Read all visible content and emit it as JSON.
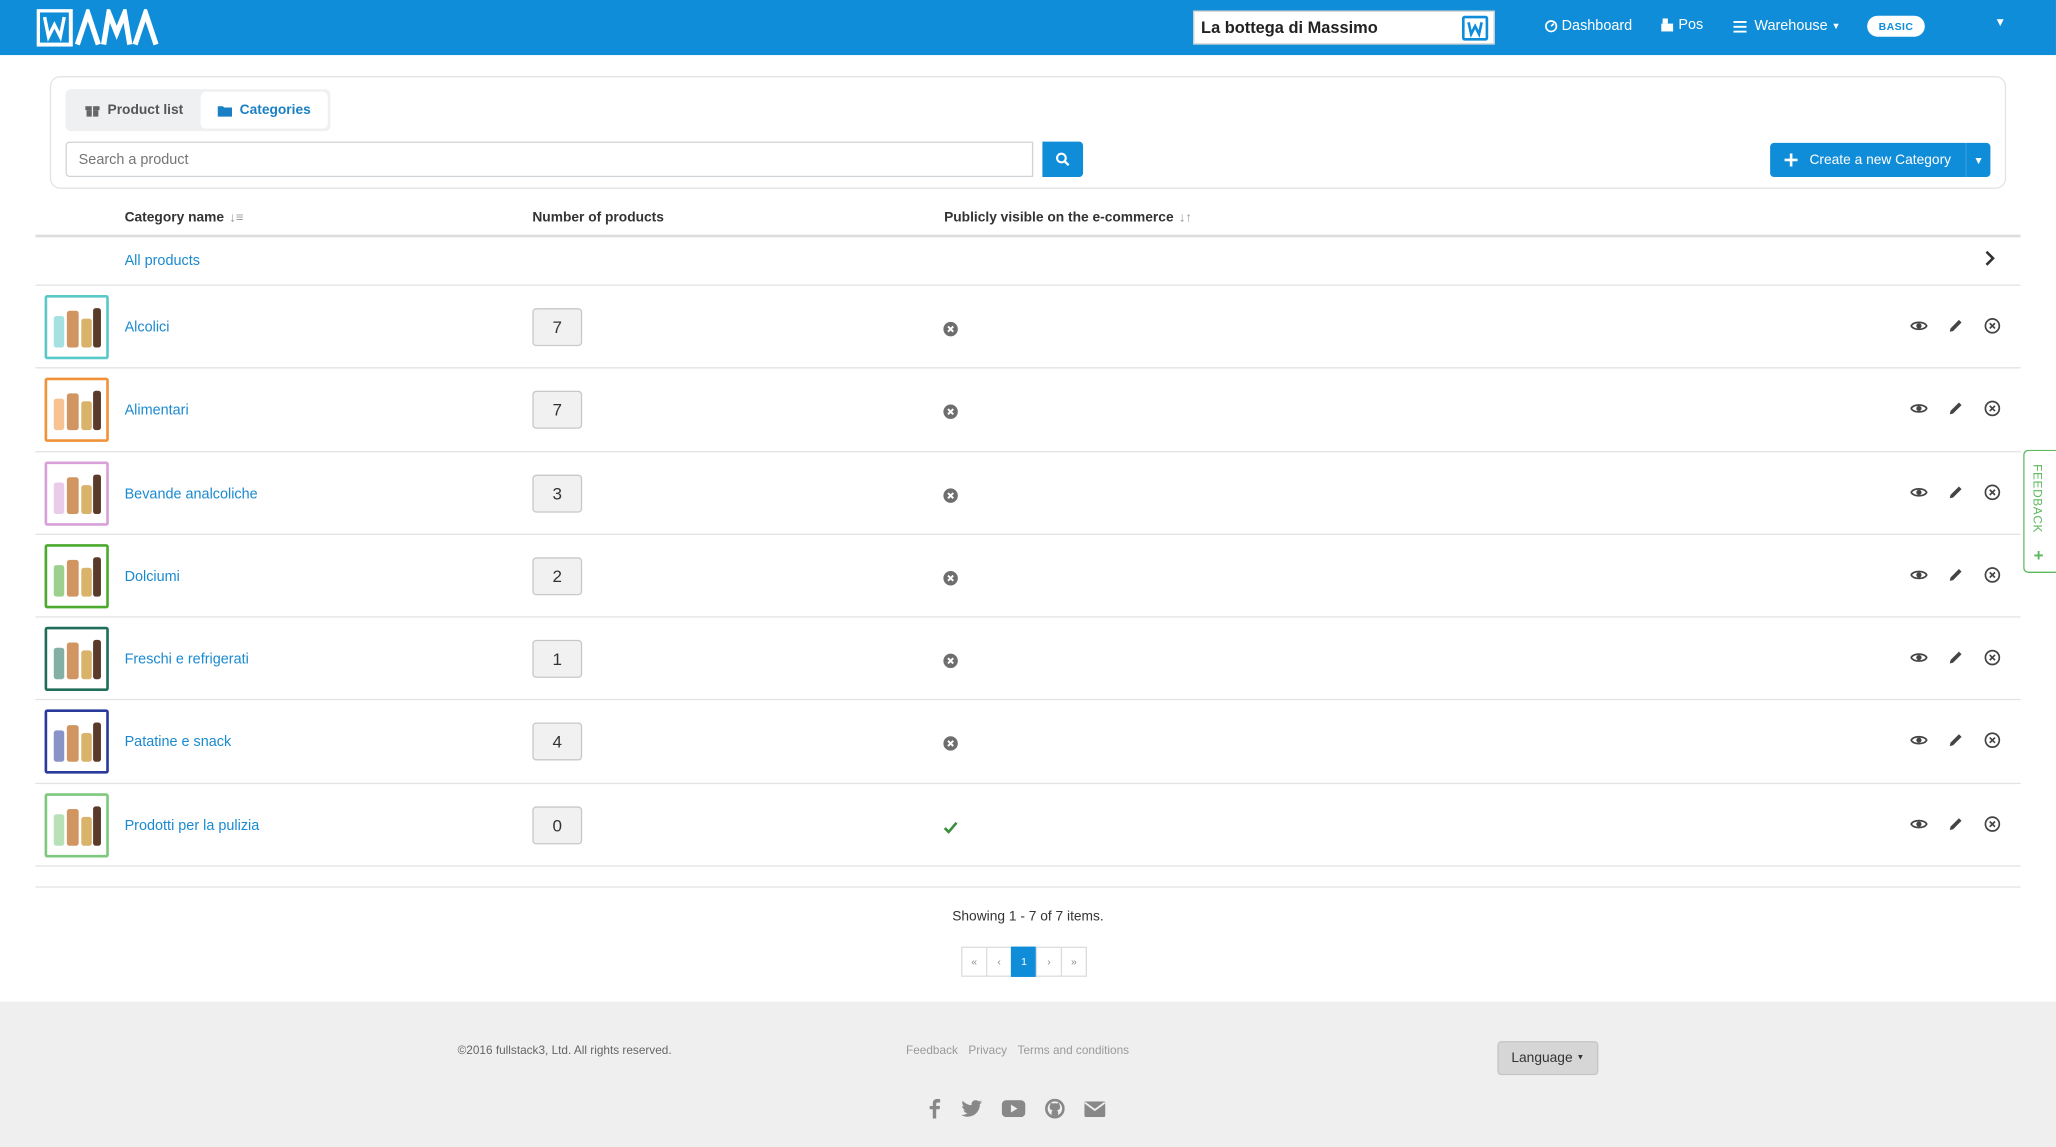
{
  "brand": {
    "logo_text": "WAMA",
    "accent": "#0f8dd8"
  },
  "header": {
    "shop_name": "La bottega di Massimo",
    "nav": [
      {
        "label": "Dashboard",
        "icon": "dashboard-icon"
      },
      {
        "label": "Pos",
        "icon": "pos-icon"
      },
      {
        "label": "Warehouse",
        "icon": "menu-icon"
      }
    ],
    "plan_badge": "BASIC"
  },
  "tabs": [
    {
      "label": "Product list",
      "icon": "gift-icon",
      "active": false
    },
    {
      "label": "Categories",
      "icon": "folder-icon",
      "active": true
    }
  ],
  "search": {
    "placeholder": "Search a product",
    "value": ""
  },
  "create_button": {
    "label": "Create a new Category"
  },
  "table": {
    "columns": {
      "name": "Category name",
      "count": "Number of products",
      "visible": "Publicly visible on the e-commerce"
    },
    "all_products_label": "All products",
    "rows": [
      {
        "name": "Alcolici",
        "count": "7",
        "visible": false,
        "color": "#5bc8c8"
      },
      {
        "name": "Alimentari",
        "count": "7",
        "visible": false,
        "color": "#f0923a"
      },
      {
        "name": "Bevande analcoliche",
        "count": "3",
        "visible": false,
        "color": "#d8a0d8"
      },
      {
        "name": "Dolciumi",
        "count": "2",
        "visible": false,
        "color": "#4caa2e"
      },
      {
        "name": "Freschi e refrigerati",
        "count": "1",
        "visible": false,
        "color": "#1f6e5a"
      },
      {
        "name": "Patatine e snack",
        "count": "4",
        "visible": false,
        "color": "#2a3a9a"
      },
      {
        "name": "Prodotti per la pulizia",
        "count": "0",
        "visible": true,
        "color": "#7ec87e"
      }
    ]
  },
  "pagination": {
    "summary": "Showing 1 - 7 of 7 items.",
    "pages": [
      "«",
      "‹",
      "1",
      "›",
      "»"
    ],
    "current": "1"
  },
  "footer": {
    "copyright": "©2016 fullstack3, Ltd. All rights reserved.",
    "links": [
      "Feedback",
      "Privacy",
      "Terms and conditions"
    ],
    "language_label": "Language",
    "social_icons": [
      "facebook-icon",
      "twitter-icon",
      "youtube-icon",
      "github-icon",
      "email-icon"
    ]
  },
  "feedback_tab": {
    "label": "FEEDBACK"
  }
}
